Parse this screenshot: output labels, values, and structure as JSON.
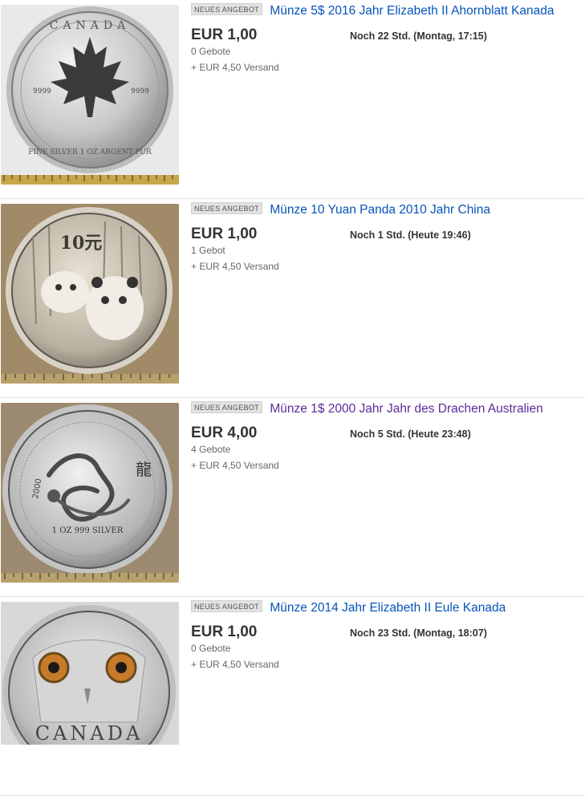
{
  "listings": [
    {
      "badge": "Neues Angebot",
      "title": "Münze 5$ 2016 Jahr Elizabeth II Ahornblatt Kanada",
      "price": "EUR 1,00",
      "time_left": "Noch 22 Std. (Montag, 17:15)",
      "bids": "0 Gebote",
      "shipping": "+ EUR 4,50 Versand",
      "visited": false,
      "image": "maple-leaf-coin",
      "coin_text": [
        "CANADA",
        "9999",
        "9999",
        "FINE SILVER 1 OZ ARGENT PUR"
      ]
    },
    {
      "badge": "Neues Angebot",
      "title": "Münze 10 Yuan Panda 2010 Jahr China",
      "price": "EUR 1,00",
      "time_left": "Noch 1 Std. (Heute 19:46)",
      "bids": "1 Gebot",
      "shipping": "+ EUR 4,50 Versand",
      "visited": false,
      "image": "panda-coin",
      "coin_text": [
        "10元"
      ]
    },
    {
      "badge": "Neues Angebot",
      "title": "Münze 1$ 2000 Jahr Jahr des Drachen Australien",
      "price": "EUR 4,00",
      "time_left": "Noch 5 Std. (Heute 23:48)",
      "bids": "4 Gebote",
      "shipping": "+ EUR 4,50 Versand",
      "visited": true,
      "image": "dragon-coin",
      "coin_text": [
        "2000",
        "龍",
        "1 OZ 999 SILVER"
      ]
    },
    {
      "badge": "Neues Angebot",
      "title": "Münze 2014 Jahr Elizabeth II Eule Kanada",
      "price": "EUR 1,00",
      "time_left": "Noch 23 Std. (Montag, 18:07)",
      "bids": "0 Gebote",
      "shipping": "+ EUR 4,50 Versand",
      "visited": false,
      "image": "owl-coin",
      "coin_text": [
        "CANADA"
      ]
    }
  ],
  "colors": {
    "link": "#0654ba",
    "visited_link": "#5f2c98",
    "badge_bg": "#e2e2e2"
  }
}
